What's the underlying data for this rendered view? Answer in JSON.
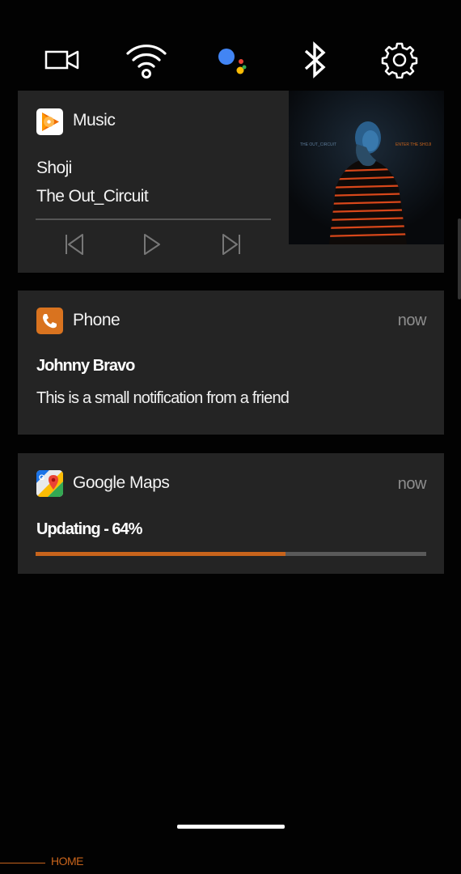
{
  "quick_settings": [
    {
      "icon": "video-camera-icon"
    },
    {
      "icon": "wifi-icon"
    },
    {
      "icon": "google-assistant-icon"
    },
    {
      "icon": "bluetooth-icon"
    },
    {
      "icon": "settings-gear-icon"
    }
  ],
  "music": {
    "app_name": "Music",
    "track": "Shoji",
    "artist": "The Out_Circuit",
    "album_art": {
      "text_left": "THE OUT_CIRCUIT",
      "text_right": "ENTER THE SHOJI"
    },
    "controls": {
      "previous_icon": "skip-previous-icon",
      "play_icon": "play-icon",
      "next_icon": "skip-next-icon"
    }
  },
  "phone": {
    "app_name": "Phone",
    "time": "now",
    "caller": "Johnny Bravo",
    "message": "This is a small notification from a friend"
  },
  "maps": {
    "app_name": "Google Maps",
    "time": "now",
    "progress_label": "Updating - 64%",
    "progress": 0.64
  },
  "bottom": {
    "home_label": "HOME"
  },
  "colors": {
    "background": "#020202",
    "card": "#242424",
    "accent": "#c8641c",
    "muted_text": "#8e8e8e"
  }
}
